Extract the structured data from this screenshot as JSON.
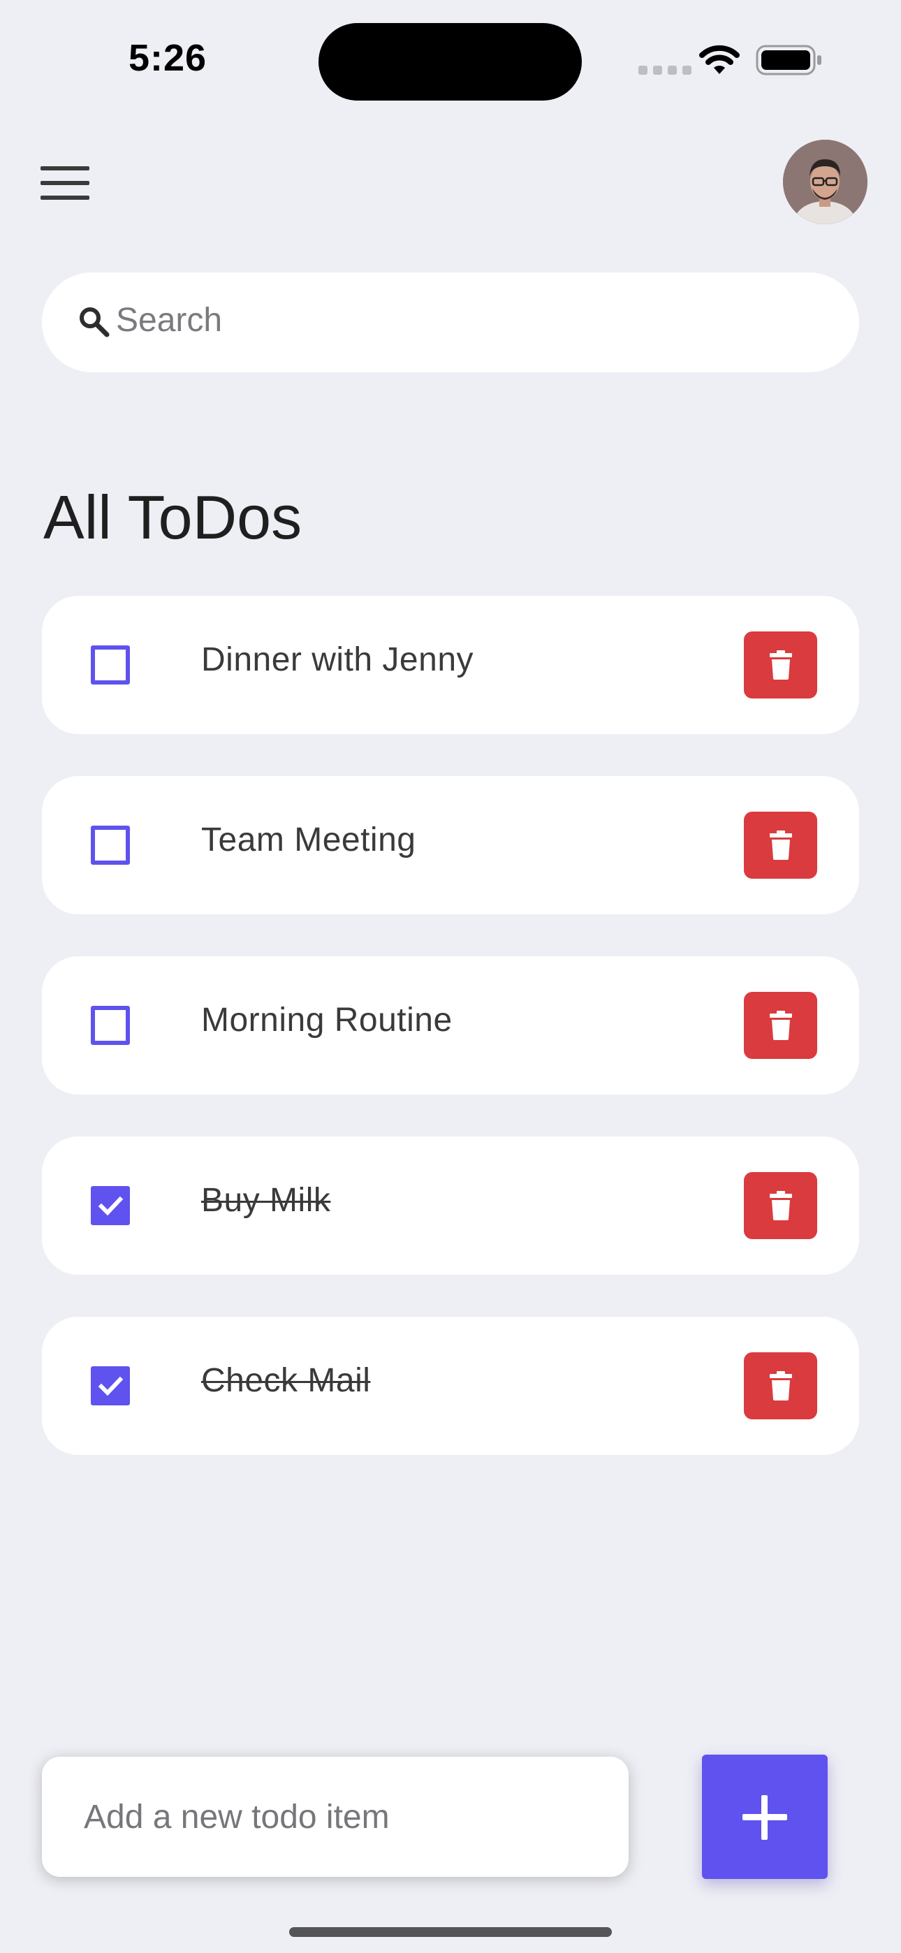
{
  "status_bar": {
    "time": "5:26",
    "icons": [
      "signal-icon",
      "wifi-icon",
      "battery-icon"
    ]
  },
  "header": {
    "menu_icon": "hamburger-menu-icon",
    "avatar": "user-avatar"
  },
  "search": {
    "placeholder": "Search",
    "value": "",
    "icon": "search-icon"
  },
  "title": "All ToDos",
  "todos": [
    {
      "text": "Dinner with Jenny",
      "done": false
    },
    {
      "text": "Team Meeting",
      "done": false
    },
    {
      "text": "Morning Routine",
      "done": false
    },
    {
      "text": "Buy Milk",
      "done": true
    },
    {
      "text": "Check Mail",
      "done": true
    }
  ],
  "new_todo": {
    "placeholder": "Add a new todo item",
    "value": "",
    "add_icon": "plus-icon"
  },
  "colors": {
    "background": "#EEEFF5",
    "accent": "#5F52EE",
    "delete": "#DA3B3E",
    "text": "#3A3A3A",
    "card": "#FFFFFF"
  }
}
